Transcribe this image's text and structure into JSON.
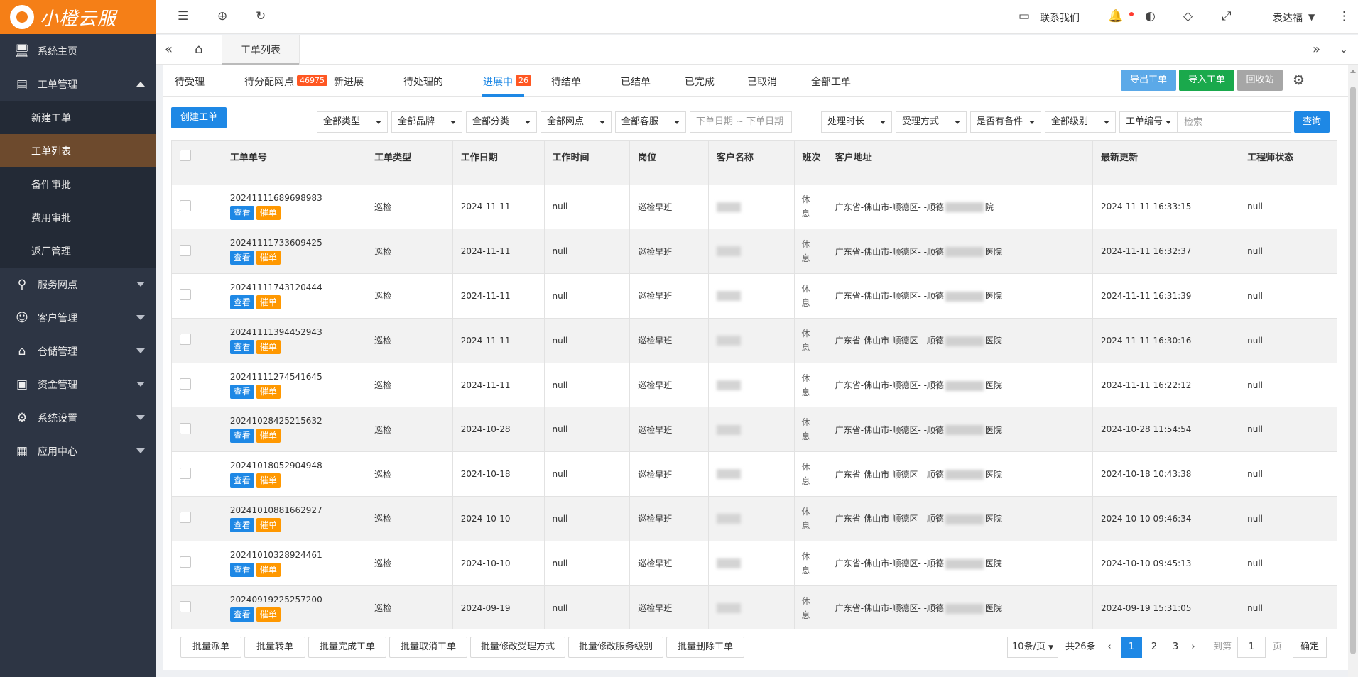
{
  "brand": {
    "name": "小橙云服"
  },
  "sidebar": {
    "items": [
      {
        "label": "系统主页",
        "icon": "monitor-icon"
      },
      {
        "label": "工单管理",
        "icon": "document-icon",
        "expanded": true,
        "children": [
          "新建工单",
          "工单列表",
          "备件审批",
          "费用审批",
          "返厂管理"
        ],
        "active_child": "工单列表"
      },
      {
        "label": "服务网点",
        "icon": "location-icon"
      },
      {
        "label": "客户管理",
        "icon": "user-icon"
      },
      {
        "label": "仓储管理",
        "icon": "bank-icon"
      },
      {
        "label": "资金管理",
        "icon": "money-icon"
      },
      {
        "label": "系统设置",
        "icon": "gear-icon"
      },
      {
        "label": "应用中心",
        "icon": "grid-icon"
      }
    ]
  },
  "topbar": {
    "contact": "联系我们",
    "user": "袁达福"
  },
  "tabbar": {
    "current_tab": "工单列表"
  },
  "status_tabs": [
    {
      "label": "待受理",
      "badge": ""
    },
    {
      "label": "待分配网点",
      "badge": "46975"
    },
    {
      "label": "新进展",
      "badge": ""
    },
    {
      "label": "待处理的",
      "badge": ""
    },
    {
      "label": "进展中",
      "badge": "26"
    },
    {
      "label": "待结单",
      "badge": ""
    },
    {
      "label": "已结单",
      "badge": ""
    },
    {
      "label": "已完成",
      "badge": ""
    },
    {
      "label": "已取消",
      "badge": ""
    },
    {
      "label": "全部工单",
      "badge": ""
    }
  ],
  "actions": {
    "export": "导出工单",
    "import": "导入工单",
    "recycle": "回收站",
    "create": "创建工单",
    "query": "查询"
  },
  "filters": {
    "type": "全部类型",
    "brand": "全部品牌",
    "category": "全部分类",
    "outlet": "全部网点",
    "service": "全部客服",
    "date_range": "下单日期 ~ 下单日期",
    "duration": "处理时长",
    "accept_method": "受理方式",
    "spare_parts": "是否有备件",
    "level": "全部级别",
    "search_field": "工单编号",
    "search_placeholder": "检索"
  },
  "table": {
    "headers": [
      "工单单号",
      "工单类型",
      "工作日期",
      "工作时间",
      "岗位",
      "客户名称",
      "班次",
      "客户地址",
      "最新更新",
      "工程师状态"
    ],
    "view_label": "查看",
    "urge_label": "催单",
    "rows": [
      {
        "no": "20241111689698983",
        "type": "巡检",
        "date": "2024-11-11",
        "time": "null",
        "post": "巡检早班",
        "shift": "休息",
        "addr_pre": "广东省-佛山市-顺德区- -顺德",
        "addr_post": "院",
        "updated": "2024-11-11 16:33:15",
        "eng": "null"
      },
      {
        "no": "20241111733609425",
        "type": "巡检",
        "date": "2024-11-11",
        "time": "null",
        "post": "巡检早班",
        "shift": "休息",
        "addr_pre": "广东省-佛山市-顺德区- -顺德",
        "addr_post": "医院",
        "updated": "2024-11-11 16:32:37",
        "eng": "null"
      },
      {
        "no": "20241111743120444",
        "type": "巡检",
        "date": "2024-11-11",
        "time": "null",
        "post": "巡检早班",
        "shift": "休息",
        "addr_pre": "广东省-佛山市-顺德区- -顺德",
        "addr_post": "医院",
        "updated": "2024-11-11 16:31:39",
        "eng": "null"
      },
      {
        "no": "20241111394452943",
        "type": "巡检",
        "date": "2024-11-11",
        "time": "null",
        "post": "巡检早班",
        "shift": "休息",
        "addr_pre": "广东省-佛山市-顺德区- -顺德",
        "addr_post": "医院",
        "updated": "2024-11-11 16:30:16",
        "eng": "null"
      },
      {
        "no": "20241111274541645",
        "type": "巡检",
        "date": "2024-11-11",
        "time": "null",
        "post": "巡检早班",
        "shift": "休息",
        "addr_pre": "广东省-佛山市-顺德区- -顺德",
        "addr_post": "医院",
        "updated": "2024-11-11 16:22:12",
        "eng": "null"
      },
      {
        "no": "20241028425215632",
        "type": "巡检",
        "date": "2024-10-28",
        "time": "null",
        "post": "巡检早班",
        "shift": "休息",
        "addr_pre": "广东省-佛山市-顺德区- -顺德",
        "addr_post": "医院",
        "updated": "2024-10-28 11:54:54",
        "eng": "null"
      },
      {
        "no": "20241018052904948",
        "type": "巡检",
        "date": "2024-10-18",
        "time": "null",
        "post": "巡检早班",
        "shift": "休息",
        "addr_pre": "广东省-佛山市-顺德区- -顺德",
        "addr_post": "医院",
        "updated": "2024-10-18 10:43:38",
        "eng": "null"
      },
      {
        "no": "20241010881662927",
        "type": "巡检",
        "date": "2024-10-10",
        "time": "null",
        "post": "巡检早班",
        "shift": "休息",
        "addr_pre": "广东省-佛山市-顺德区- -顺德",
        "addr_post": "医院",
        "updated": "2024-10-10 09:46:34",
        "eng": "null"
      },
      {
        "no": "20241010328924461",
        "type": "巡检",
        "date": "2024-10-10",
        "time": "null",
        "post": "巡检早班",
        "shift": "休息",
        "addr_pre": "广东省-佛山市-顺德区- -顺德",
        "addr_post": "医院",
        "updated": "2024-10-10 09:45:13",
        "eng": "null"
      },
      {
        "no": "20240919225257200",
        "type": "巡检",
        "date": "2024-09-19",
        "time": "null",
        "post": "巡检早班",
        "shift": "休息",
        "addr_pre": "广东省-佛山市-顺德区- -顺德",
        "addr_post": "医院",
        "updated": "2024-09-19 15:31:05",
        "eng": "null"
      }
    ]
  },
  "bulk_actions": [
    "批量派单",
    "批量转单",
    "批量完成工单",
    "批量取消工单",
    "批量修改受理方式",
    "批量修改服务级别",
    "批量删除工单"
  ],
  "pagination": {
    "page_size": "10条/页",
    "total": "共26条",
    "pages": [
      "1",
      "2",
      "3"
    ],
    "current": "1",
    "goto_label": "到第",
    "goto_value": "1",
    "page_unit": "页",
    "confirm": "确定"
  },
  "colors": {
    "primary": "#1e88e5",
    "brand_orange": "#f57f17",
    "success": "#1aa94c",
    "warning": "#ff9800",
    "badge": "#ff5722"
  }
}
